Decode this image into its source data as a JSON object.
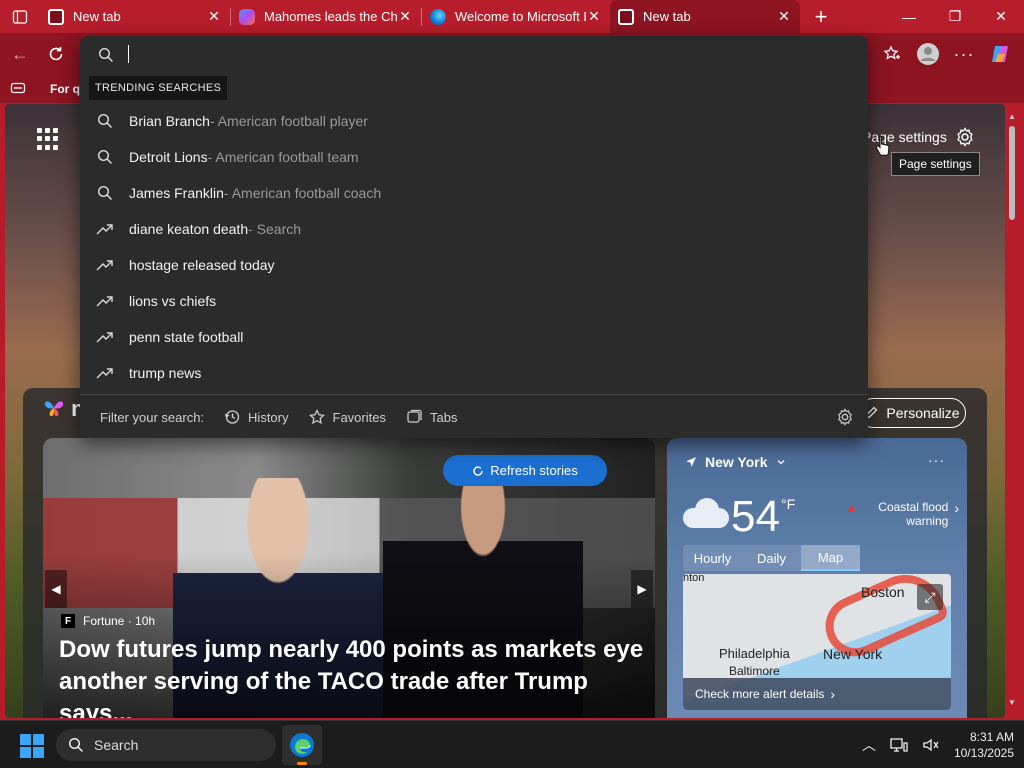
{
  "tabs": [
    {
      "title": "New tab",
      "favicon": "new-tab-favicon",
      "color": "#c62828",
      "active": false
    },
    {
      "title": "Mahomes leads the Chi",
      "favicon": "copilot-favicon",
      "color": "#8e5cf4",
      "active": false
    },
    {
      "title": "Welcome to Microsoft E",
      "favicon": "edge-favicon",
      "color": "#0e9de0",
      "active": false
    },
    {
      "title": "New tab",
      "favicon": "new-tab-favicon",
      "color": "#c62828",
      "active": true
    }
  ],
  "favorites_bar": {
    "item_label": "For qu"
  },
  "omnibox": {
    "section_label": "TRENDING SEARCHES",
    "suggestions": [
      {
        "query": "Brian Branch",
        "meta": " - American football player",
        "icon": "search-icon"
      },
      {
        "query": "Detroit Lions",
        "meta": " - American football team",
        "icon": "search-icon"
      },
      {
        "query": "James Franklin",
        "meta": " - American football coach",
        "icon": "search-icon"
      },
      {
        "query": "diane keaton death",
        "meta": " - Search",
        "icon": "trending-icon"
      },
      {
        "query": "hostage released today",
        "meta": "",
        "icon": "trending-icon"
      },
      {
        "query": "lions vs chiefs",
        "meta": "",
        "icon": "trending-icon"
      },
      {
        "query": "penn state football",
        "meta": "",
        "icon": "trending-icon"
      },
      {
        "query": "trump news",
        "meta": "",
        "icon": "trending-icon"
      }
    ],
    "filter_label": "Filter your search:",
    "filters": [
      "History",
      "Favorites",
      "Tabs"
    ]
  },
  "page": {
    "settings_label": "Page settings",
    "settings_tooltip": "Page settings",
    "brand_letter": "n",
    "personalize_label": "Personalize",
    "refresh_label": "Refresh stories"
  },
  "hero": {
    "source_logo": "F",
    "source": "Fortune · 10h",
    "headline": "Dow futures jump nearly 400 points as markets eye another serving of the TACO trade after Trump says..."
  },
  "weather": {
    "location": "New York",
    "temperature": "54",
    "unit": "°F",
    "alert": "Coastal flood warning",
    "tabs": [
      "Hourly",
      "Daily",
      "Map"
    ],
    "active_tab": "Map",
    "map_labels": [
      "nton",
      "Boston",
      "Philadelphia",
      "Baltimore",
      "New York"
    ],
    "cta": "Check more alert details"
  },
  "taskbar": {
    "search_label": "Search",
    "time": "8:31 AM",
    "date": "10/13/2025"
  },
  "colors": {
    "accent": "#b81d2c",
    "toolbar": "#8e1422",
    "dropdown": "#2b2b2b",
    "refresh_button": "#1b6fd1"
  }
}
